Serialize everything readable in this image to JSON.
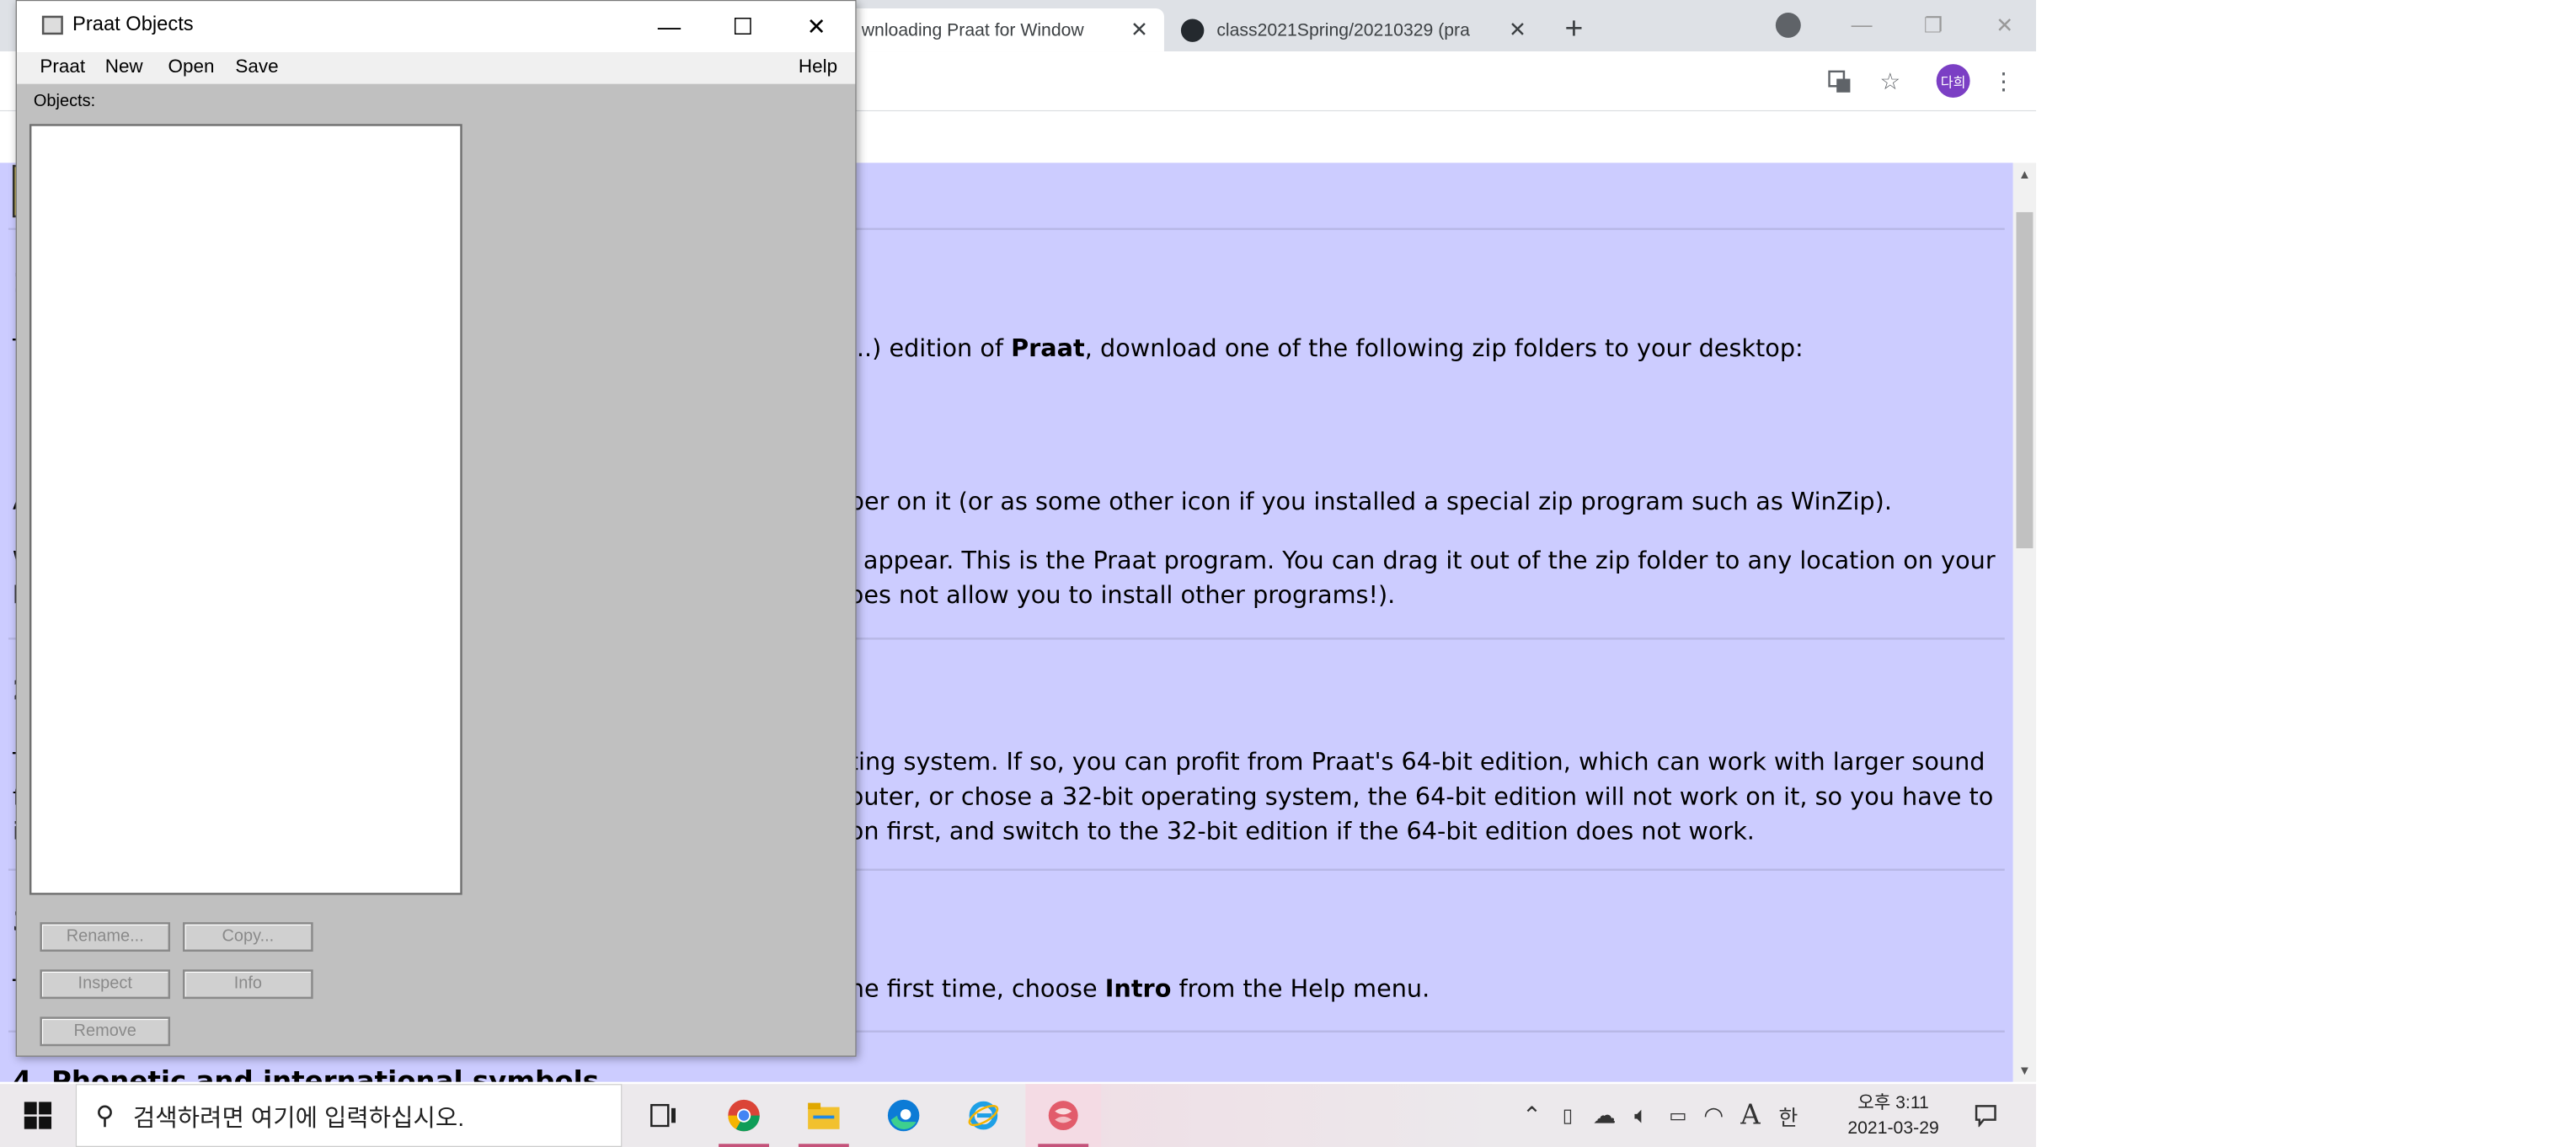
{
  "browser": {
    "tabs": [
      {
        "label": "wnloading Praat for Window",
        "close": "✕"
      },
      {
        "label": "class2021Spring/20210329 (pra",
        "close": "✕"
      }
    ],
    "new_tab": "+",
    "profile_initials": "다희"
  },
  "page": {
    "lines": [
      {
        "text": "...) edition of Praat, download one of the following zip folders to your desktop:"
      },
      {
        "text": "per on it (or as some other icon if you installed a special zip program such as WinZip)."
      },
      {
        "text": "l appear. This is the Praat program. You can drag it out of the zip folder to any location on your"
      },
      {
        "text": "oes not allow you to install other programs!)."
      },
      {
        "text": "ting system. If so, you can profit from Praat's 64-bit edition, which can work with larger sound"
      },
      {
        "text": "outer, or chose a 32-bit operating system, the 64-bit edition will not work on it, so you have to"
      },
      {
        "text": "on first, and switch to the 32-bit edition if the 64-bit edition does not work."
      },
      {
        "text": "he first time, choose Intro from the Help menu."
      }
    ],
    "left_fragments": [
      "1",
      "T",
      "A",
      "W",
      "h",
      "2",
      "T",
      "fi",
      "in",
      "3",
      "T"
    ],
    "bottom_heading": "4. Phonetic and international symbols"
  },
  "praat": {
    "title": "Praat Objects",
    "menu": [
      "Praat",
      "New",
      "Open",
      "Save",
      "Help"
    ],
    "objects_label": "Objects:",
    "buttons": {
      "rename": "Rename...",
      "copy": "Copy...",
      "inspect": "Inspect",
      "info": "Info",
      "remove": "Remove"
    }
  },
  "taskbar": {
    "search_placeholder": "검색하려면 여기에 입력하십시오.",
    "ime_a": "A",
    "ime_han": "한",
    "time": "오후 3:11",
    "date": "2021-03-29"
  }
}
